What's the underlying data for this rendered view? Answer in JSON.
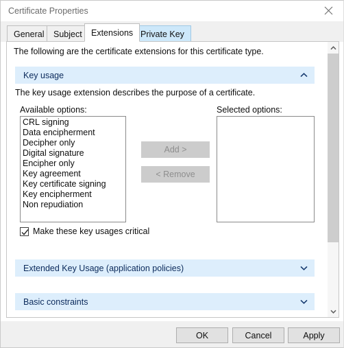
{
  "window": {
    "title": "Certificate Properties",
    "close_icon": "close-icon"
  },
  "tabs": [
    {
      "label": "General",
      "state": "inactive"
    },
    {
      "label": "Subject",
      "state": "inactive"
    },
    {
      "label": "Extensions",
      "state": "active"
    },
    {
      "label": "Private Key",
      "state": "hover"
    }
  ],
  "content": {
    "intro": "The following are the certificate extensions for this certificate type.",
    "key_usage": {
      "header": "Key usage",
      "chevron_icon": "chevron-up-icon",
      "description": "The key usage extension describes the purpose of a certificate.",
      "available_label": "Available options:",
      "available_options": [
        "CRL signing",
        "Data encipherment",
        "Decipher only",
        "Digital signature",
        "Encipher only",
        "Key agreement",
        "Key certificate signing",
        "Key encipherment",
        "Non repudiation"
      ],
      "selected_label": "Selected options:",
      "selected_options": [],
      "add_button": "Add >",
      "remove_button": "< Remove",
      "critical_checkbox": {
        "label": "Make these key usages critical",
        "checked": true,
        "check_icon": "checkmark-icon"
      }
    },
    "collapsed_sections": [
      {
        "header": "Extended Key Usage (application policies)",
        "chevron_icon": "chevron-down-icon"
      },
      {
        "header": "Basic constraints",
        "chevron_icon": "chevron-down-icon"
      }
    ]
  },
  "scrollbar": {
    "up_icon": "scroll-up-arrow-icon",
    "down_icon": "scroll-down-arrow-icon",
    "thumb": "scrollbar-thumb"
  },
  "footer": {
    "ok": "OK",
    "cancel": "Cancel",
    "apply": "Apply"
  },
  "colors": {
    "section_header_bg": "#ddeefc",
    "section_header_text": "#0b2a5b",
    "tab_hover_bg": "#cde8fa",
    "footer_bg": "#f0f0f0",
    "disabled_button_bg": "#cccccc",
    "disabled_button_text": "#8e8e8e",
    "scroll_thumb": "#cdcdcd"
  }
}
